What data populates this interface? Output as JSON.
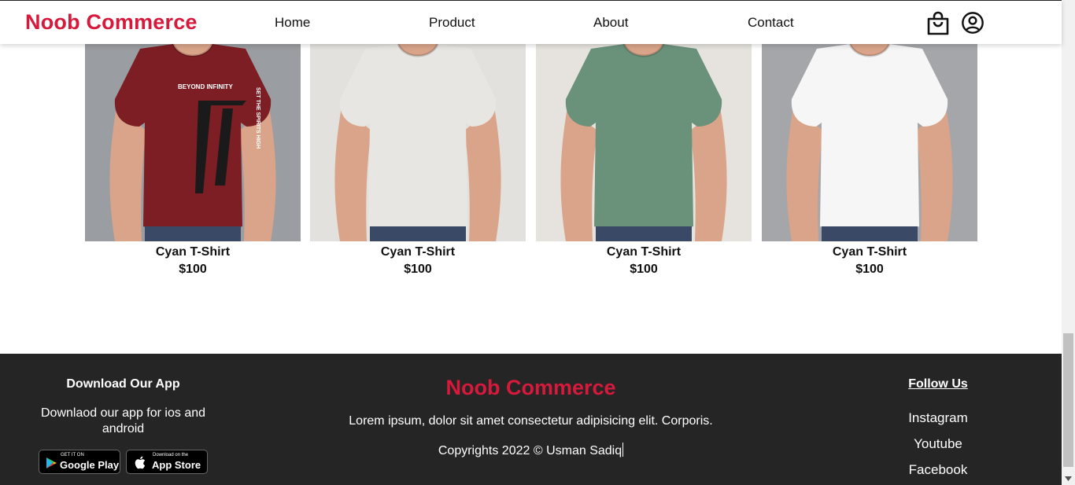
{
  "header": {
    "logo": "Noob Commerce",
    "nav": [
      "Home",
      "Product",
      "About",
      "Contact"
    ]
  },
  "products": [
    {
      "name": "Cyan T-Shirt",
      "price": "$100",
      "shirt_color": "#7d1e24",
      "bg": "#9a9da1",
      "print_top": "BEYOND INFINITY",
      "print_side": "SET THE SPIRITS HIGH"
    },
    {
      "name": "Cyan T-Shirt",
      "price": "$100",
      "shirt_color": "#e7e6e2",
      "bg": "#e3e1dd"
    },
    {
      "name": "Cyan T-Shirt",
      "price": "$100",
      "shirt_color": "#6a927b",
      "bg": "#e6e3de"
    },
    {
      "name": "Cyan T-Shirt",
      "price": "$100",
      "shirt_color": "#f6f6f6",
      "bg": "#a5a6aa"
    }
  ],
  "footer": {
    "download_title": "Download Our App",
    "download_desc": "Downlaod our app for ios and android",
    "google_play": {
      "small": "GET IT ON",
      "big": "Google Play"
    },
    "app_store": {
      "small": "Download on the",
      "big": "App Store"
    },
    "brand": "Noob Commerce",
    "lorem": "Lorem ipsum, dolor sit amet consectetur adipisicing elit. Corporis.",
    "copyright": "Copyrights 2022 © Usman Sadiq",
    "follow_title": "Follow Us",
    "social": [
      "Instagram",
      "Youtube",
      "Facebook"
    ]
  },
  "colors": {
    "brand": "#d7193c",
    "footer_bg": "#252525"
  },
  "icons": {
    "cart": "shopping-bag-icon",
    "user": "user-circle-icon"
  }
}
